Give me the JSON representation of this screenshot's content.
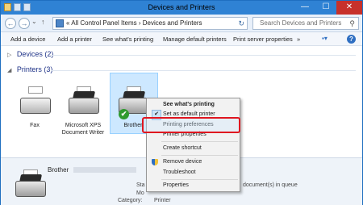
{
  "window": {
    "title": "Devices and Printers",
    "buttons": {
      "minimize": "—",
      "maximize": "☐",
      "close": "✕"
    }
  },
  "address": {
    "back": "←",
    "forward": "→",
    "dropdown": "⌄",
    "up": "↑",
    "path_sep1": "«",
    "path_part1": "All Control Panel Items",
    "path_sep2": "›",
    "path_part2": "Devices and Printers",
    "refresh": "↻",
    "search_placeholder": "Search Devices and Printers",
    "search_icon": "⚲"
  },
  "toolbar": {
    "add_device": "Add a device",
    "add_printer": "Add a printer",
    "see_printing": "See what's printing",
    "manage_default": "Manage default printers",
    "print_server": "Print server properties",
    "more": "»",
    "view": "▪▾",
    "help": "?"
  },
  "groups": {
    "devices": {
      "arrow": "▷",
      "label": "Devices (2)"
    },
    "printers": {
      "arrow": "◢",
      "label": "Printers (3)"
    }
  },
  "printers": [
    {
      "label": "Fax"
    },
    {
      "label": "Microsoft XPS Document Writer"
    },
    {
      "label": "Brother"
    }
  ],
  "checkmark": "✔",
  "context_menu": {
    "items": [
      {
        "label": "See what's printing"
      },
      {
        "label": "Set as default printer"
      },
      {
        "label": "Printing preferences"
      },
      {
        "label": "Printer properties"
      },
      {
        "label": "Create shortcut"
      },
      {
        "label": "Remove device"
      },
      {
        "label": "Troubleshoot"
      },
      {
        "label": "Properties"
      }
    ]
  },
  "details": {
    "name": "Brother",
    "state_label": "Sta",
    "state_value": "document(s) in queue",
    "model_label": "Mo",
    "category_label": "Category:",
    "category_value": "Printer"
  }
}
